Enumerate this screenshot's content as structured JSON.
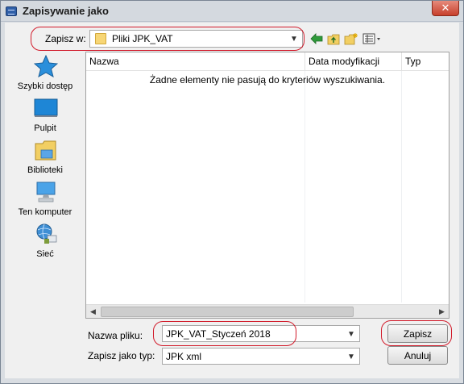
{
  "window": {
    "title": "Zapisywanie jako",
    "close_glyph": "✕"
  },
  "save_in": {
    "label": "Zapisz w:",
    "value": "Pliki JPK_VAT"
  },
  "toolbar": {
    "icons": [
      "back-arrow-icon",
      "up-folder-icon",
      "new-folder-icon",
      "view-menu-icon"
    ]
  },
  "places": [
    {
      "label": "Szybki dostęp",
      "icon": "quick-access-star-icon"
    },
    {
      "label": "Pulpit",
      "icon": "desktop-icon"
    },
    {
      "label": "Biblioteki",
      "icon": "libraries-icon"
    },
    {
      "label": "Ten komputer",
      "icon": "this-pc-icon"
    },
    {
      "label": "Sieć",
      "icon": "network-icon"
    }
  ],
  "file_list": {
    "columns": [
      "Nazwa",
      "Data modyfikacji",
      "Typ"
    ],
    "empty_message": "Żadne elementy nie pasują do kryteriów wyszukiwania."
  },
  "filename": {
    "label": "Nazwa pliku:",
    "value": "JPK_VAT_Styczeń 2018"
  },
  "filetype": {
    "label": "Zapisz jako typ:",
    "value": "JPK xml"
  },
  "buttons": {
    "save": "Zapisz",
    "cancel": "Anuluj"
  },
  "colors": {
    "annotation": "#d11a2a",
    "accent": "#2f5fa8"
  }
}
